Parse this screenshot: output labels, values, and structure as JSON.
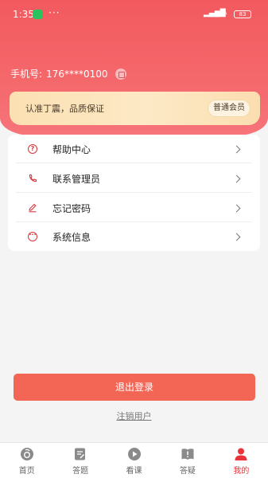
{
  "status_bar": {
    "time": "1:35",
    "dots": "···",
    "battery": "83"
  },
  "profile": {
    "phone_label": "手机号:",
    "phone_number": "176****0100"
  },
  "member": {
    "slogan": "认准丁震，品质保证",
    "level": "普通会员"
  },
  "menu": [
    {
      "label": "帮助中心",
      "icon": "question-circle-icon"
    },
    {
      "label": "联系管理员",
      "icon": "phone-icon"
    },
    {
      "label": "忘记密码",
      "icon": "pencil-icon"
    },
    {
      "label": "系统信息",
      "icon": "info-dots-icon"
    }
  ],
  "actions": {
    "logout": "退出登录",
    "cancel": "注销用户"
  },
  "tabs": [
    {
      "label": "首页",
      "icon": "home-icon",
      "active": false
    },
    {
      "label": "答题",
      "icon": "quiz-icon",
      "active": false
    },
    {
      "label": "看课",
      "icon": "play-icon",
      "active": false
    },
    {
      "label": "答疑",
      "icon": "qa-book-icon",
      "active": false
    },
    {
      "label": "我的",
      "icon": "user-icon",
      "active": true
    }
  ],
  "colors": {
    "brand_red": "#f25a5f",
    "accent": "#e8343a",
    "button": "#f36655",
    "gold": "#fbe0b2"
  }
}
